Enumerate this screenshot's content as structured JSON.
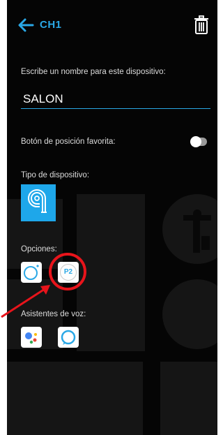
{
  "header": {
    "title": "CH1",
    "back_icon": "arrow-left-icon",
    "delete_icon": "trash-icon"
  },
  "name_section": {
    "label": "Escribe un nombre para este dispositivo:",
    "value": "SALON"
  },
  "favorite": {
    "label": "Botón de posición favorita:",
    "enabled": false
  },
  "device_type": {
    "label": "Tipo de dispositivo:",
    "icon": "shutter-icon"
  },
  "options": {
    "label": "Opciones:",
    "items": [
      {
        "icon": "dot-circle-icon"
      },
      {
        "icon": "p2-icon",
        "text": "P2"
      }
    ]
  },
  "voice_assistants": {
    "label": "Asistentes de voz:",
    "items": [
      {
        "icon": "google-assistant-icon"
      },
      {
        "icon": "alexa-icon"
      }
    ]
  },
  "colors": {
    "accent": "#2aa8e6",
    "background": "#050505",
    "highlight": "#e8141b"
  }
}
